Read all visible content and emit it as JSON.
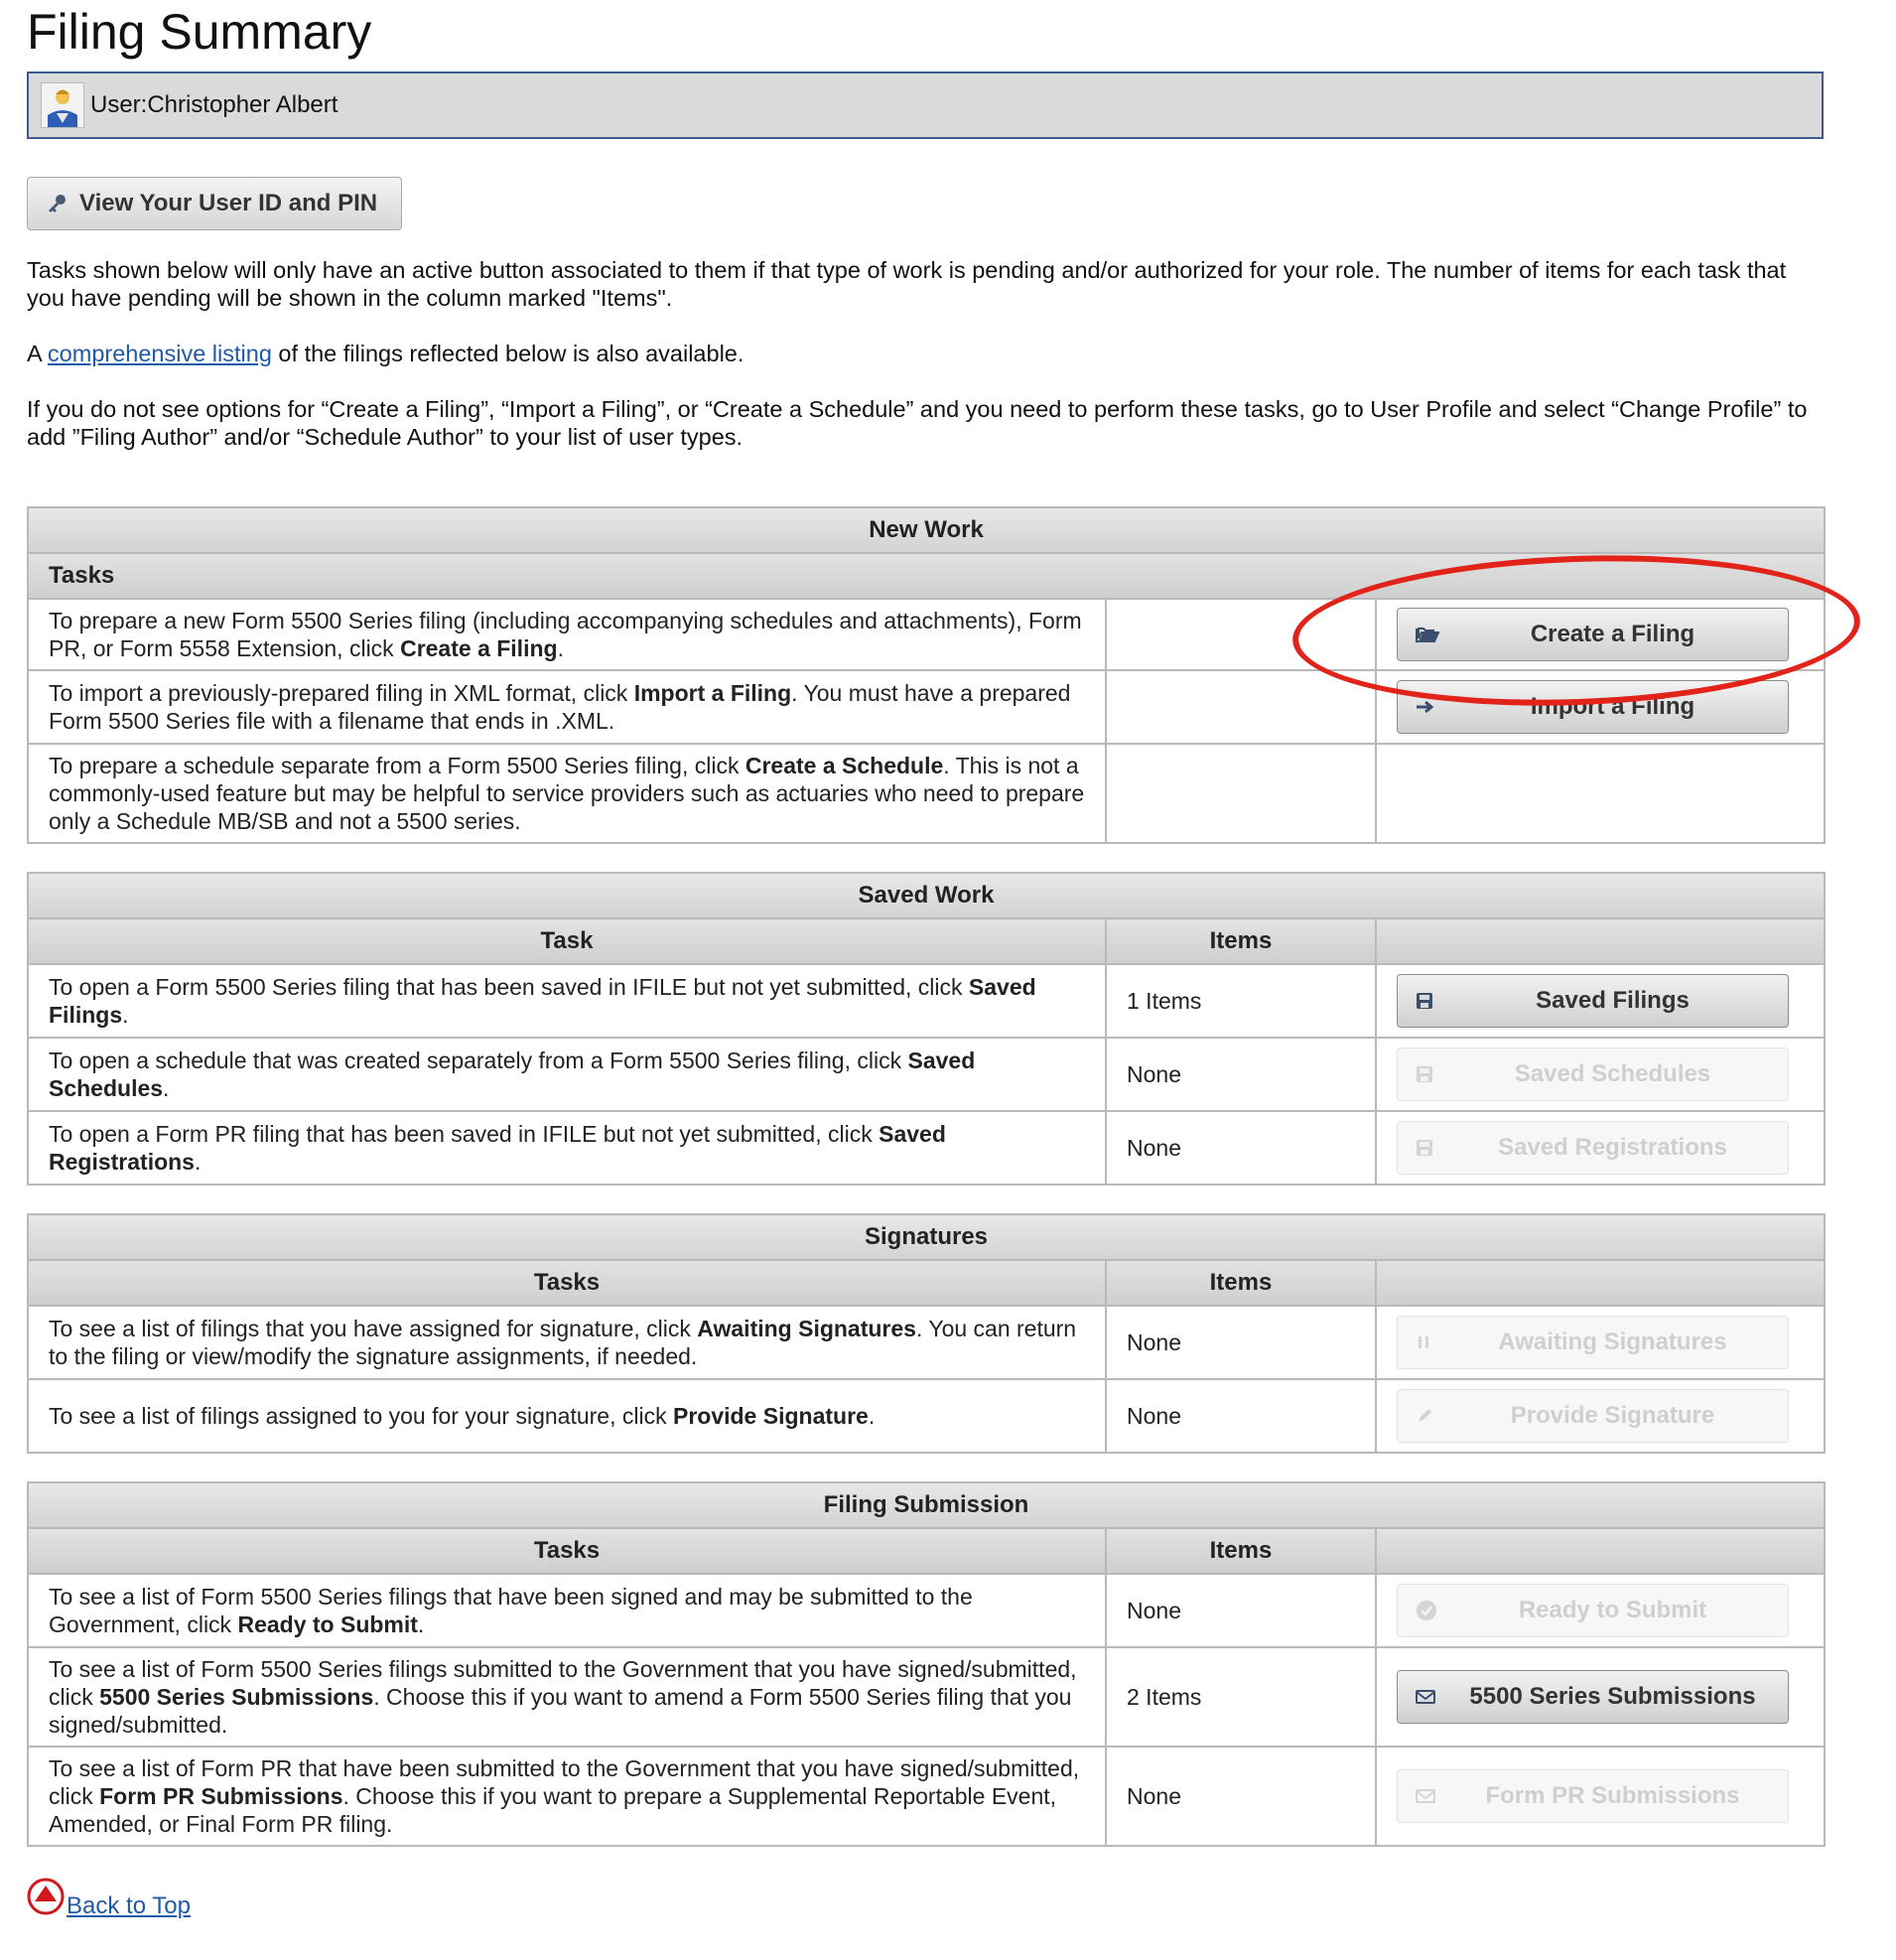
{
  "page": {
    "title": "Filing Summary"
  },
  "user": {
    "label": "User:Christopher Albert"
  },
  "pin_button": {
    "label": "View Your User ID and PIN"
  },
  "intro": {
    "p1": "Tasks shown below will only have an active button associated to them if that type of work is pending and/or authorized for your role. The number of items for each task that you have pending will be shown in the column marked \"Items\".",
    "p2_prefix": "A ",
    "p2_link": "comprehensive listing",
    "p2_suffix": " of the filings reflected below is also available.",
    "p3": "If you do not see options for “Create a Filing”, “Import a Filing”, or “Create a Schedule” and you need to perform these tasks, go to User Profile and select “Change Profile” to add ”Filing Author” and/or “Schedule Author” to your list of user types."
  },
  "new_work": {
    "title": "New Work",
    "tasks_header": "Tasks",
    "rows": [
      {
        "pre": "To prepare a new Form 5500 Series filing (including accompanying schedules and attachments), Form PR, or Form 5558 Extension, click ",
        "bold": "Create a Filing",
        "post": ".",
        "button": "Create a Filing",
        "icon": "folder-open-icon"
      },
      {
        "pre": "To import a previously-prepared filing in XML format, click ",
        "bold": "Import a Filing",
        "post": ". You must have a prepared Form 5500 Series file with a filename that ends in .XML.",
        "button": "Import a Filing",
        "icon": "arrow-right-icon"
      },
      {
        "pre": "To prepare a schedule separate from a Form 5500 Series filing, click ",
        "bold": "Create a Schedule",
        "post": ". This is not a commonly-used feature but may be helpful to service providers such as actuaries who need to prepare only a Schedule MB/SB and not a 5500 series."
      }
    ]
  },
  "saved_work": {
    "title": "Saved Work",
    "headers": {
      "task": "Task",
      "items": "Items"
    },
    "rows": [
      {
        "pre": "To open a Form 5500 Series filing that has been saved in IFILE but not yet submitted, click ",
        "bold": "Saved Filings",
        "post": ".",
        "items": "1 Items",
        "button": "Saved Filings",
        "icon": "save-icon",
        "active": true
      },
      {
        "pre": "To open a schedule that was created separately from a Form 5500 Series filing, click ",
        "bold": "Saved Schedules",
        "post": ".",
        "items": "None",
        "button": "Saved Schedules",
        "icon": "save-icon",
        "active": false
      },
      {
        "pre": "To open a Form PR filing that has been saved in IFILE but not yet submitted, click ",
        "bold": "Saved Registrations",
        "post": ".",
        "items": "None",
        "button": "Saved Registrations",
        "icon": "save-icon",
        "active": false
      }
    ]
  },
  "signatures": {
    "title": "Signatures",
    "headers": {
      "task": "Tasks",
      "items": "Items"
    },
    "rows": [
      {
        "pre": "To see a list of filings that you have assigned for signature, click ",
        "bold": "Awaiting Signatures",
        "post": ". You can return to the filing or view/modify the signature assignments, if needed.",
        "items": "None",
        "button": "Awaiting Signatures",
        "icon": "pause-icon",
        "active": false
      },
      {
        "pre": "To see a list of filings assigned to you for your signature, click ",
        "bold": "Provide Signature",
        "post": ".",
        "items": "None",
        "button": "Provide Signature",
        "icon": "pen-icon",
        "active": false
      }
    ]
  },
  "submission": {
    "title": "Filing Submission",
    "headers": {
      "task": "Tasks",
      "items": "Items"
    },
    "rows": [
      {
        "pre": "To see a list of Form 5500 Series filings that have been signed and may be submitted to the Government, click ",
        "bold": "Ready to Submit",
        "post": ".",
        "items": "None",
        "button": "Ready to Submit",
        "icon": "check-circle-icon",
        "active": false
      },
      {
        "pre": "To see a list of Form 5500 Series filings submitted to the Government that you have signed/submitted, click ",
        "bold": "5500 Series Submissions",
        "post": ". Choose this if you want to amend a Form 5500 Series filing that you signed/submitted.",
        "items": "2 Items",
        "button": "5500 Series Submissions",
        "icon": "envelope-icon",
        "active": true
      },
      {
        "pre": "To see a list of Form PR that have been submitted to the Government that you have signed/submitted, click ",
        "bold": "Form PR Submissions",
        "post": ". Choose this if you want to prepare a Supplemental Reportable Event, Amended, or Final Form PR filing.",
        "items": "None",
        "button": "Form PR Submissions",
        "icon": "envelope-icon",
        "active": false
      }
    ]
  },
  "footer": {
    "back_to_top": "Back to Top"
  },
  "colors": {
    "link": "#1f5aa6",
    "callout": "#e2231a",
    "user_bar_border": "#3f5a8c"
  }
}
